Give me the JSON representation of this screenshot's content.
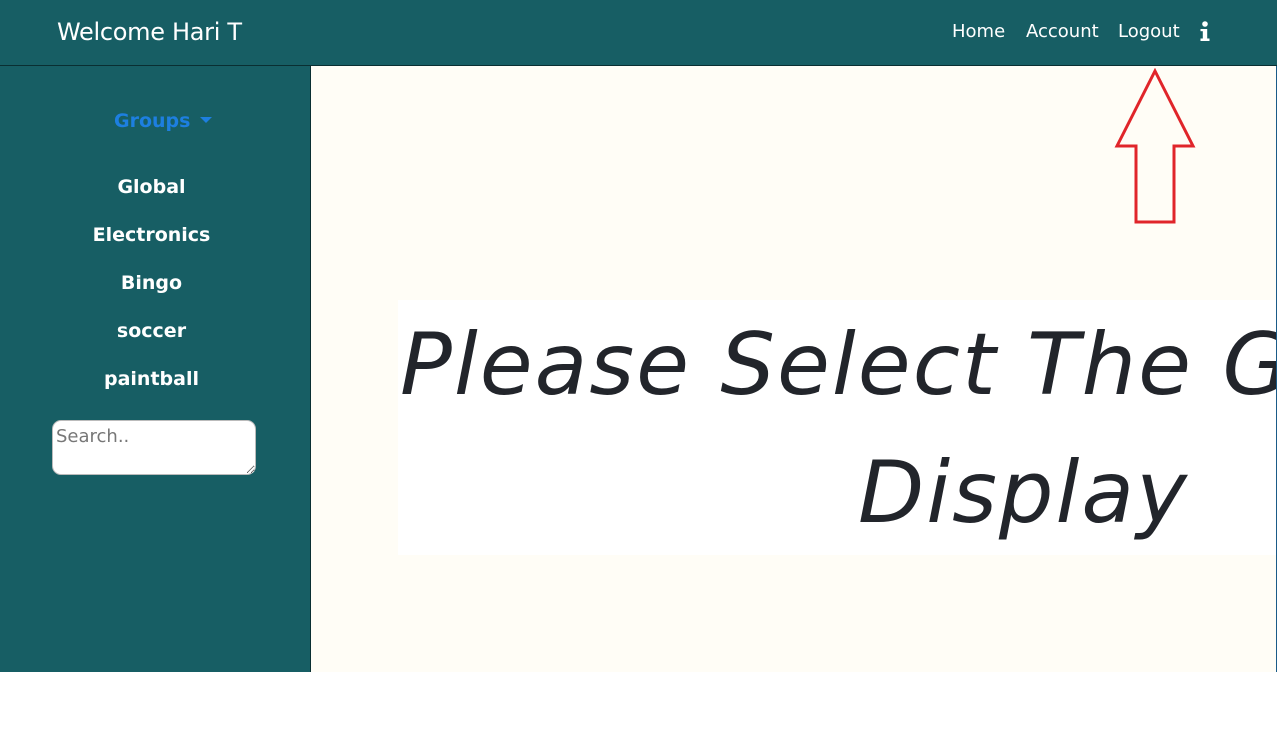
{
  "header": {
    "welcome": "Welcome Hari T",
    "nav": {
      "home": "Home",
      "account": "Account",
      "logout": "Logout"
    },
    "info_icon": "info-icon"
  },
  "sidebar": {
    "groups_label": "Groups",
    "items": [
      "Global",
      "Electronics",
      "Bingo",
      "soccer",
      "paintball"
    ],
    "search": {
      "placeholder": "Search..",
      "value": ""
    }
  },
  "main": {
    "banner_line1": "Please Select The G",
    "banner_line2": "Display"
  },
  "annotation": {
    "arrow_icon": "up-arrow-icon",
    "color": "#e0252a"
  },
  "colors": {
    "teal": "#175e64",
    "link_blue": "#1d7fe0",
    "content_bg": "#fffdf6"
  }
}
